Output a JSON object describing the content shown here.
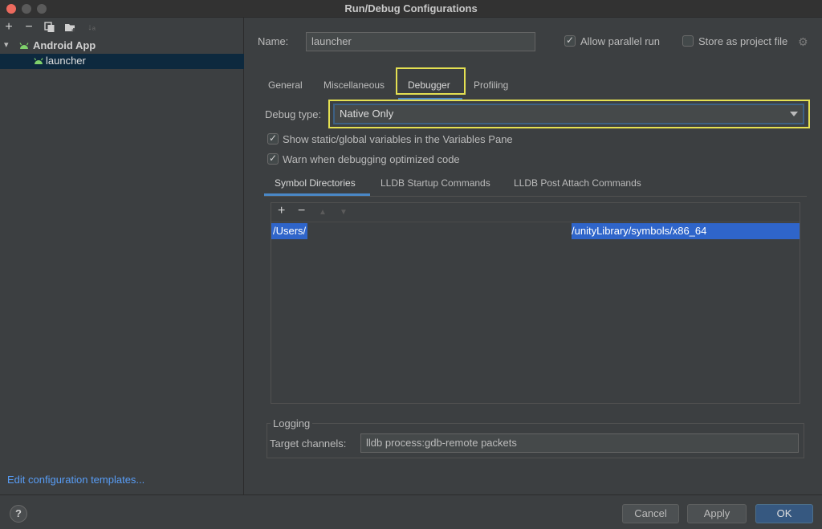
{
  "window": {
    "title": "Run/Debug Configurations"
  },
  "left": {
    "toolbar": {
      "add": "+",
      "remove": "−",
      "copy_icon": "copy-icon",
      "folder_icon": "new-folder-icon",
      "sort": "↓ₐ"
    },
    "tree": {
      "group_label": "Android App",
      "item_label": "launcher"
    },
    "edit_templates": "Edit configuration templates..."
  },
  "config": {
    "name_label": "Name:",
    "name_value": "launcher",
    "allow_parallel": "Allow parallel run",
    "store_as_project": "Store as project file"
  },
  "tabs": [
    "General",
    "Miscellaneous",
    "Debugger",
    "Profiling"
  ],
  "debugger": {
    "debug_type_label": "Debug type:",
    "debug_type_value": "Native Only",
    "show_static": "Show static/global variables in the Variables Pane",
    "warn_optimized": "Warn when debugging optimized code",
    "subtabs": [
      "Symbol Directories",
      "LLDB Startup Commands",
      "LLDB Post Attach Commands"
    ],
    "symbol_toolbar": {
      "add": "+",
      "remove": "−",
      "up": "▲",
      "down": "▼"
    },
    "symbol_row": {
      "part1": "/Users/",
      "part2": "/unityLibrary/symbols/x86_64"
    },
    "logging_title": "Logging",
    "target_label": "Target channels:",
    "target_value": "lldb process:gdb-remote packets"
  },
  "footer": {
    "help": "?",
    "cancel": "Cancel",
    "apply": "Apply",
    "ok": "OK"
  },
  "colors": {
    "accent": "#4a88c7",
    "highlight": "#e4e052",
    "selection": "#2f65ca",
    "link": "#589df6"
  }
}
